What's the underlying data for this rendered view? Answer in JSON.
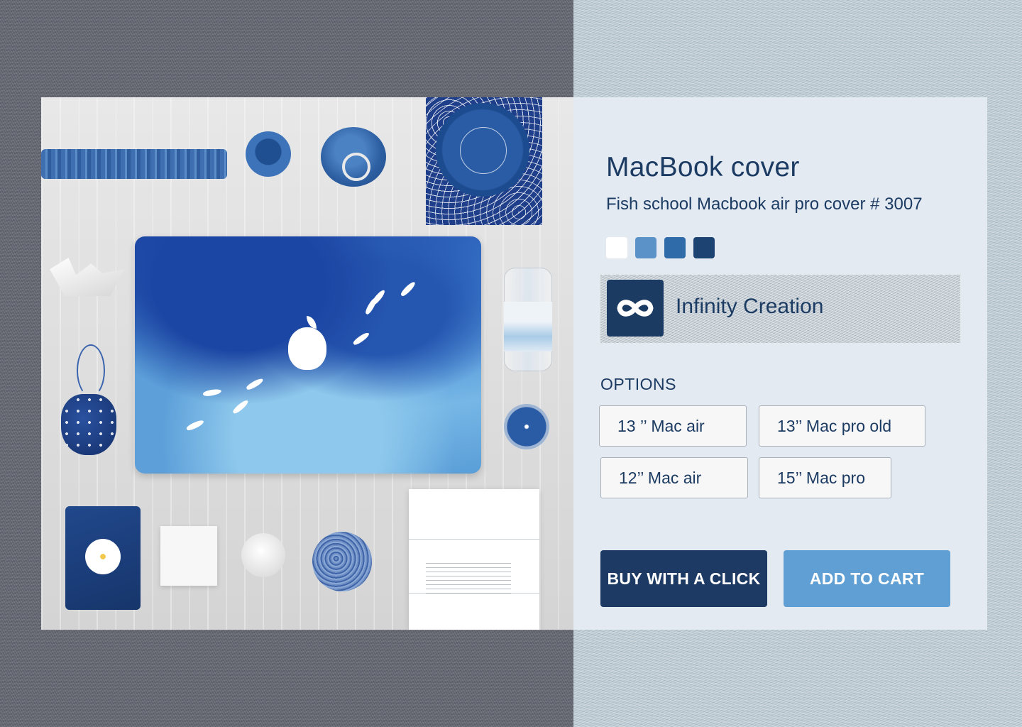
{
  "product": {
    "title": "MacBook cover",
    "subtitle": "Fish school Macbook air pro cover # 3007"
  },
  "swatches": [
    {
      "color": "#ffffff"
    },
    {
      "color": "#5b93c9"
    },
    {
      "color": "#2f6aa9"
    },
    {
      "color": "#1d4373"
    }
  ],
  "creator": {
    "name": "Infinity Creation",
    "logo_icon": "infinity-icon"
  },
  "options": {
    "label": "OPTIONS",
    "items": [
      "13 ’’ Mac air",
      "13’’ Mac pro old",
      "12’’ Mac air",
      "15’’ Mac pro"
    ]
  },
  "actions": {
    "buy_label": "BUY WITH A CLICK",
    "add_label": "ADD TO CART"
  },
  "colors": {
    "primary": "#1d3a64",
    "accent": "#609fd4",
    "panel": "#e4eaf2",
    "text": "#1c3b63"
  }
}
